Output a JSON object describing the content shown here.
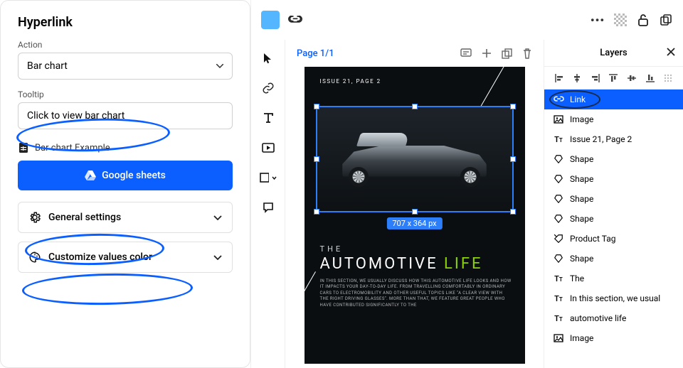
{
  "leftPanel": {
    "title": "Hyperlink",
    "actionLabel": "Action",
    "actionValue": "Bar chart",
    "tooltipLabel": "Tooltip",
    "tooltipValue": "Click to view bar chart",
    "fileLabel": "Bar chart Example",
    "googleSheetsLabel": "Google sheets",
    "generalSettings": "General settings",
    "customizeColors": "Customize values color"
  },
  "canvas": {
    "pageIndicator": "Page 1/1",
    "issueLine": "ISSUE 21, PAGE 2",
    "selectionSize": "707 x 364 px",
    "copy": {
      "the": "THE",
      "headlineA": "AUTOMOTIVE ",
      "headlineB": "LIFE",
      "body": "IN THIS SECTION, WE USUALLY DISCUSS HOW THIS AUTOMOTIVE LIFE LOOKS AND HOW IT IMPACTS YOUR DAY-TO-DAY LIFE. FROM TRAVELLING COMFORTABLY IN ORDINARY CARS TO ELECTROMOBILITY AND OTHER USEFUL TOPICS LIKE \"A CLEAR VIEW WITH THE RIGHT DRIVING GLASSES\". MORE THAN THAT, WE FEATURE GREAT PEOPLE WHO HAVE CONTRIBUTED SIGNIFICANTLY TO THE"
    }
  },
  "layers": {
    "title": "Layers",
    "items": [
      {
        "icon": "link",
        "label": "Link",
        "selected": true
      },
      {
        "icon": "image",
        "label": "Image"
      },
      {
        "icon": "text",
        "label": "Issue 21, Page 2"
      },
      {
        "icon": "shape",
        "label": "Shape"
      },
      {
        "icon": "shape",
        "label": "Shape"
      },
      {
        "icon": "shape",
        "label": "Shape"
      },
      {
        "icon": "shape",
        "label": "Shape"
      },
      {
        "icon": "tag",
        "label": "Product Tag"
      },
      {
        "icon": "shape",
        "label": "Shape"
      },
      {
        "icon": "text",
        "label": "The"
      },
      {
        "icon": "text",
        "label": "In this section, we usual"
      },
      {
        "icon": "text",
        "label": "automotive life"
      },
      {
        "icon": "image",
        "label": "Image"
      }
    ]
  }
}
